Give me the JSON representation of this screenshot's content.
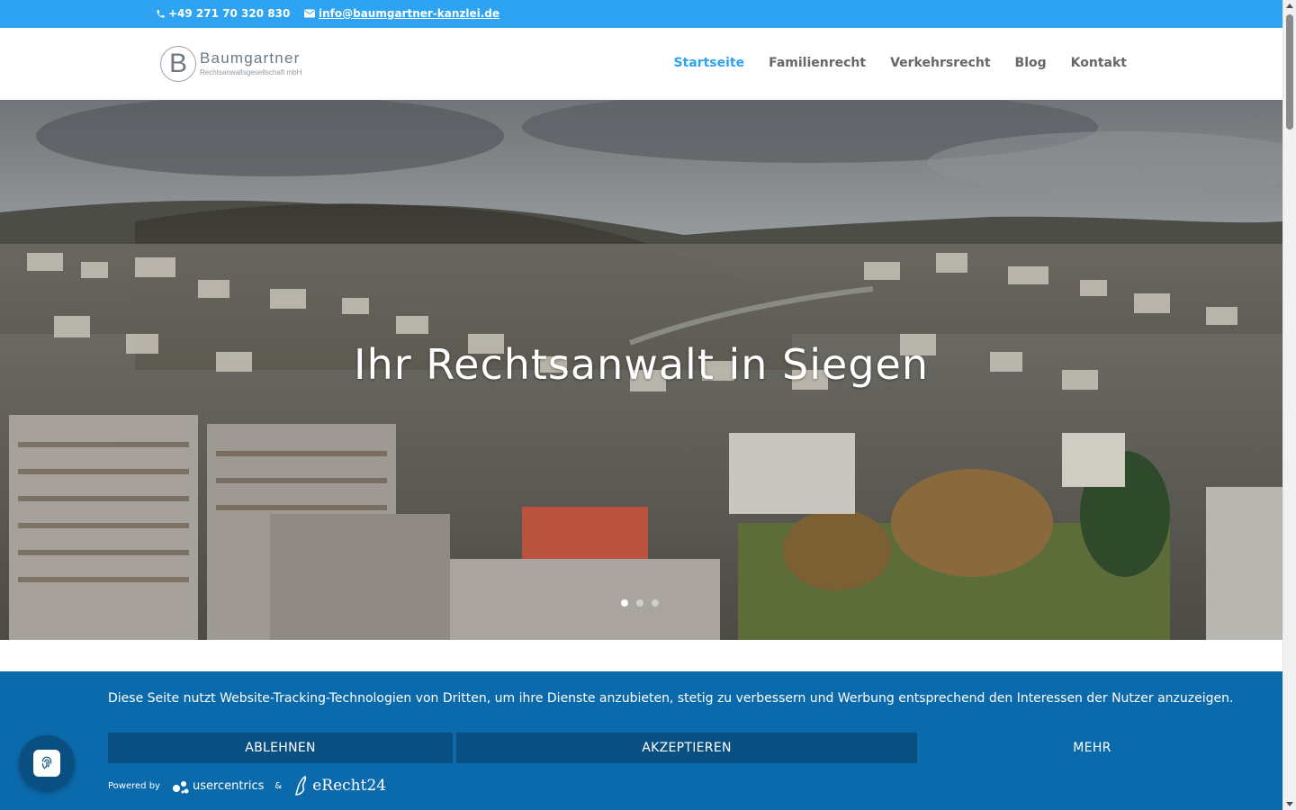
{
  "topbar": {
    "phone": "+49 271 70 320 830",
    "email": "info@baumgartner-kanzlei.de",
    "bg_color": "#2ea3f2"
  },
  "logo": {
    "letter": "B",
    "name": "Baumgartner",
    "subtitle": "Rechtsanwaltsgesellschaft mbH"
  },
  "nav": {
    "items": [
      {
        "label": "Startseite",
        "active": true
      },
      {
        "label": "Familienrecht"
      },
      {
        "label": "Verkehrsrecht"
      },
      {
        "label": "Blog"
      },
      {
        "label": "Kontakt"
      }
    ],
    "active_color": "#2ea3f2"
  },
  "hero": {
    "title": "Ihr Rechtsanwalt in Siegen",
    "slides_count": 3,
    "active_slide": 1
  },
  "consent": {
    "message": "Diese Seite nutzt Website-Tracking-Technologien von Dritten, um ihre Dienste anzubieten, stetig zu verbessern und Werbung entsprechend den Interessen der Nutzer anzuzeigen.",
    "deny_label": "ABLEHNEN",
    "accept_label": "AKZEPTIEREN",
    "more_label": "MEHR",
    "powered_by": "Powered by",
    "provider_1": "usercentrics",
    "ampersand": "&",
    "provider_2": "eRecht24",
    "bg_color": "#0b6aab"
  },
  "icons": {
    "phone": "phone-icon",
    "mail": "mail-icon",
    "privacy": "fingerprint-icon"
  }
}
